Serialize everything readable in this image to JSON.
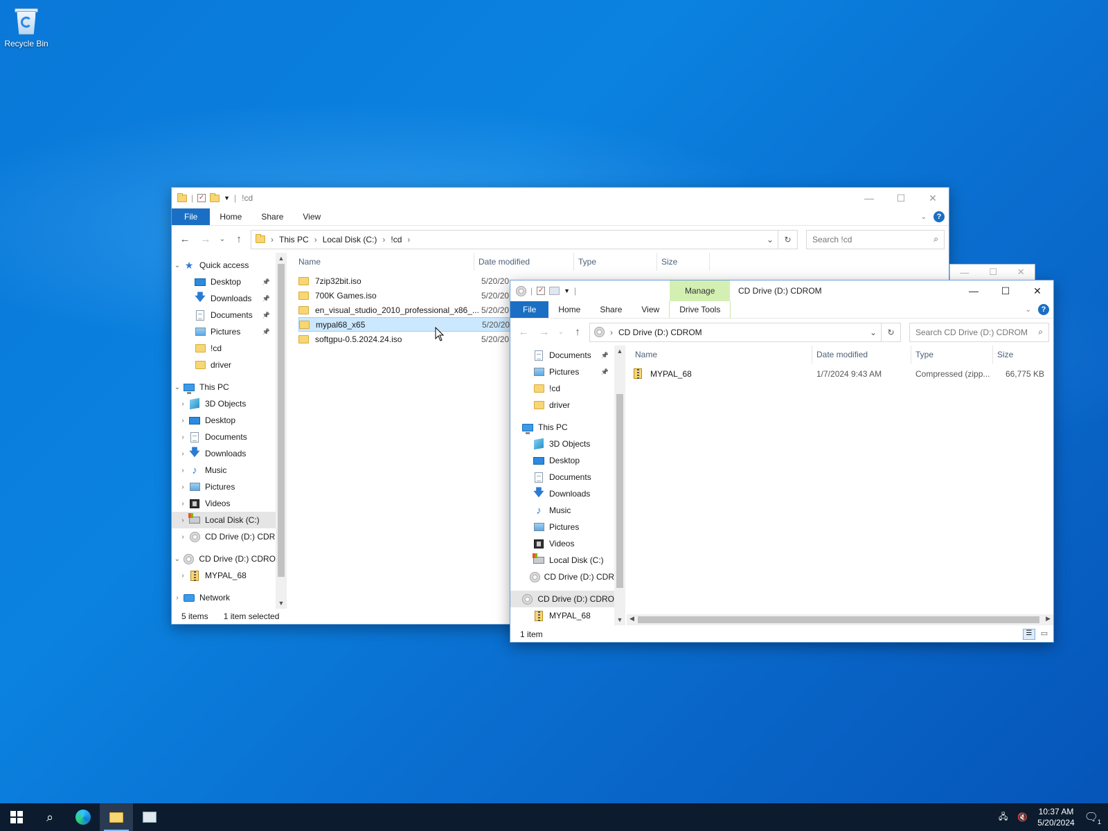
{
  "desktop": {
    "recycle_bin_label": "Recycle Bin"
  },
  "win1": {
    "title": "!cd",
    "tabs": {
      "file": "File",
      "home": "Home",
      "share": "Share",
      "view": "View"
    },
    "breadcrumb": [
      "This PC",
      "Local Disk (C:)",
      "!cd"
    ],
    "search_placeholder": "Search !cd",
    "nav": [
      {
        "label": "Quick access",
        "icon": "star-icon"
      },
      {
        "label": "Desktop",
        "icon": "desktop-icon",
        "pinned": true
      },
      {
        "label": "Downloads",
        "icon": "downloads-icon",
        "pinned": true
      },
      {
        "label": "Documents",
        "icon": "documents-icon",
        "pinned": true
      },
      {
        "label": "Pictures",
        "icon": "pictures-icon",
        "pinned": true
      },
      {
        "label": "!cd",
        "icon": "folder-icon"
      },
      {
        "label": "driver",
        "icon": "folder-icon"
      },
      {
        "label": "This PC",
        "icon": "this-pc-icon"
      },
      {
        "label": "3D Objects",
        "icon": "3d-objects-icon"
      },
      {
        "label": "Desktop",
        "icon": "desktop-icon"
      },
      {
        "label": "Documents",
        "icon": "documents-icon"
      },
      {
        "label": "Downloads",
        "icon": "downloads-icon"
      },
      {
        "label": "Music",
        "icon": "music-icon"
      },
      {
        "label": "Pictures",
        "icon": "pictures-icon"
      },
      {
        "label": "Videos",
        "icon": "videos-icon"
      },
      {
        "label": "Local Disk (C:)",
        "icon": "local-disk-icon"
      },
      {
        "label": "CD Drive (D:) CDR",
        "icon": "cd-drive-icon"
      },
      {
        "label": "CD Drive (D:) CDRO",
        "icon": "cd-drive-icon"
      },
      {
        "label": "MYPAL_68",
        "icon": "zip-icon"
      },
      {
        "label": "Network",
        "icon": "network-icon"
      }
    ],
    "columns": {
      "name": "Name",
      "date": "Date modified",
      "type": "Type",
      "size": "Size"
    },
    "files": [
      {
        "name": "7zip32bit.iso",
        "date": "5/20/20"
      },
      {
        "name": "700K Games.iso",
        "date": "5/20/20"
      },
      {
        "name": "en_visual_studio_2010_professional_x86_...",
        "date": "5/20/20"
      },
      {
        "name": "mypal68_x65",
        "date": "5/20/20"
      },
      {
        "name": "softgpu-0.5.2024.24.iso",
        "date": "5/20/20"
      }
    ],
    "status": {
      "count": "5 items",
      "selected": "1 item selected"
    }
  },
  "win2": {
    "title": "CD Drive (D:) CDROM",
    "manage_label": "Manage",
    "tabs": {
      "file": "File",
      "home": "Home",
      "share": "Share",
      "view": "View",
      "drive_tools": "Drive Tools"
    },
    "breadcrumb": "CD Drive (D:) CDROM",
    "search_placeholder": "Search CD Drive (D:) CDROM",
    "nav": [
      {
        "label": "Documents",
        "icon": "documents-icon",
        "pinned": true
      },
      {
        "label": "Pictures",
        "icon": "pictures-icon",
        "pinned": true
      },
      {
        "label": "!cd",
        "icon": "folder-icon"
      },
      {
        "label": "driver",
        "icon": "folder-icon"
      },
      {
        "label": "This PC",
        "icon": "this-pc-icon"
      },
      {
        "label": "3D Objects",
        "icon": "3d-objects-icon"
      },
      {
        "label": "Desktop",
        "icon": "desktop-icon"
      },
      {
        "label": "Documents",
        "icon": "documents-icon"
      },
      {
        "label": "Downloads",
        "icon": "downloads-icon"
      },
      {
        "label": "Music",
        "icon": "music-icon"
      },
      {
        "label": "Pictures",
        "icon": "pictures-icon"
      },
      {
        "label": "Videos",
        "icon": "videos-icon"
      },
      {
        "label": "Local Disk (C:)",
        "icon": "local-disk-icon"
      },
      {
        "label": "CD Drive (D:) CDR",
        "icon": "cd-drive-icon"
      },
      {
        "label": "CD Drive (D:) CDRO",
        "icon": "cd-drive-icon"
      },
      {
        "label": "MYPAL_68",
        "icon": "zip-icon"
      }
    ],
    "columns": {
      "name": "Name",
      "date": "Date modified",
      "type": "Type",
      "size": "Size"
    },
    "files": [
      {
        "name": "MYPAL_68",
        "date": "1/7/2024 9:43 AM",
        "type": "Compressed (zipp...",
        "size": "66,775 KB"
      }
    ],
    "status": {
      "count": "1 item"
    }
  },
  "taskbar": {
    "time": "10:37 AM",
    "date": "5/20/2024",
    "notifications": "1"
  },
  "colors": {
    "accent": "#1a6fc4",
    "selection": "#cce8ff",
    "manage_tab": "#d3f0b2",
    "taskbar": "#0c1b2e"
  }
}
